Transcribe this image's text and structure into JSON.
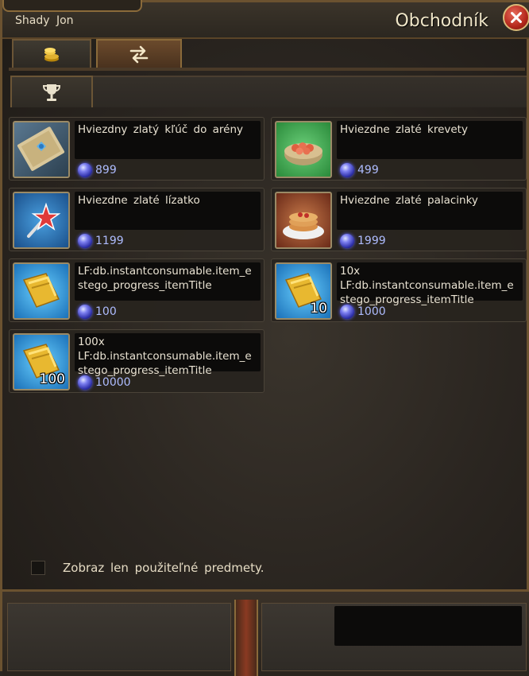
{
  "header": {
    "trader_name": "Shady Jon",
    "title": "Obchodník",
    "close_icon": "close-icon"
  },
  "tabs": [
    {
      "icon": "gold-coins-icon",
      "active": false
    },
    {
      "icon": "exchange-arrows-icon",
      "active": true
    }
  ],
  "subtabs": [
    {
      "icon": "trophy-icon",
      "active": true
    }
  ],
  "items": [
    {
      "title": "Hviezdny zlatý kľúč do arény",
      "price": "899",
      "icon": "arena-ticket-icon",
      "qty": ""
    },
    {
      "title": "Hviezdne zlaté krevety",
      "price": "499",
      "icon": "shrimp-bowl-icon",
      "qty": ""
    },
    {
      "title": "Hviezdne zlaté lízatko",
      "price": "1199",
      "icon": "star-lollipop-icon",
      "qty": ""
    },
    {
      "title": "Hviezdne zlaté palacinky",
      "price": "1999",
      "icon": "pancakes-icon",
      "qty": ""
    },
    {
      "title": "LF:db.instantconsumable.item_e\nstego_progress_itemTitle",
      "price": "100",
      "icon": "gold-scroll-icon",
      "qty": ""
    },
    {
      "title": "10x\nLF:db.instantconsumable.item_e\nstego_progress_itemTitle",
      "price": "1000",
      "icon": "gold-scroll-icon",
      "qty": "10"
    },
    {
      "title": "100x\nLF:db.instantconsumable.item_e\nstego_progress_itemTitle",
      "price": "10000",
      "icon": "gold-scroll-icon",
      "qty": "100"
    }
  ],
  "currency_icon": "blue-gem-icon",
  "filter": {
    "label": "Zobraz len použiteľné predmety.",
    "checked": false
  },
  "colors": {
    "price_text": "#aebcff",
    "title_text": "#e9e2d2",
    "frame": "#6b5230"
  }
}
